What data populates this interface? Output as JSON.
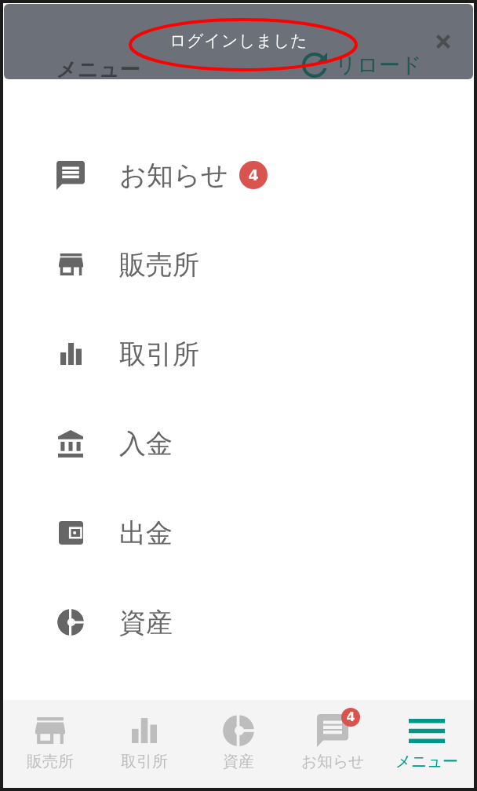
{
  "header": {
    "title": "メニュー",
    "reload": {
      "label": "リロード"
    }
  },
  "toast": {
    "message": "ログインしました",
    "dismissible": true
  },
  "annotation": {
    "kind": "ellipse"
  },
  "menu": {
    "items": [
      {
        "kind": "chat",
        "label": "お知らせ",
        "badge": "4"
      },
      {
        "kind": "store",
        "label": "販売所"
      },
      {
        "kind": "bars",
        "label": "取引所"
      },
      {
        "kind": "bank",
        "label": "入金"
      },
      {
        "kind": "wallet",
        "label": "出金"
      },
      {
        "kind": "pie",
        "label": "資産"
      }
    ]
  },
  "tab_bar": {
    "tabs": [
      {
        "kind": "store",
        "label": "販売所",
        "selected": false
      },
      {
        "kind": "bars",
        "label": "取引所",
        "selected": false
      },
      {
        "kind": "pie",
        "label": "資産",
        "selected": false
      },
      {
        "kind": "chat",
        "label": "お知らせ",
        "badge": "4",
        "selected": false
      },
      {
        "kind": "menu",
        "label": "メニュー",
        "selected": true
      }
    ]
  }
}
